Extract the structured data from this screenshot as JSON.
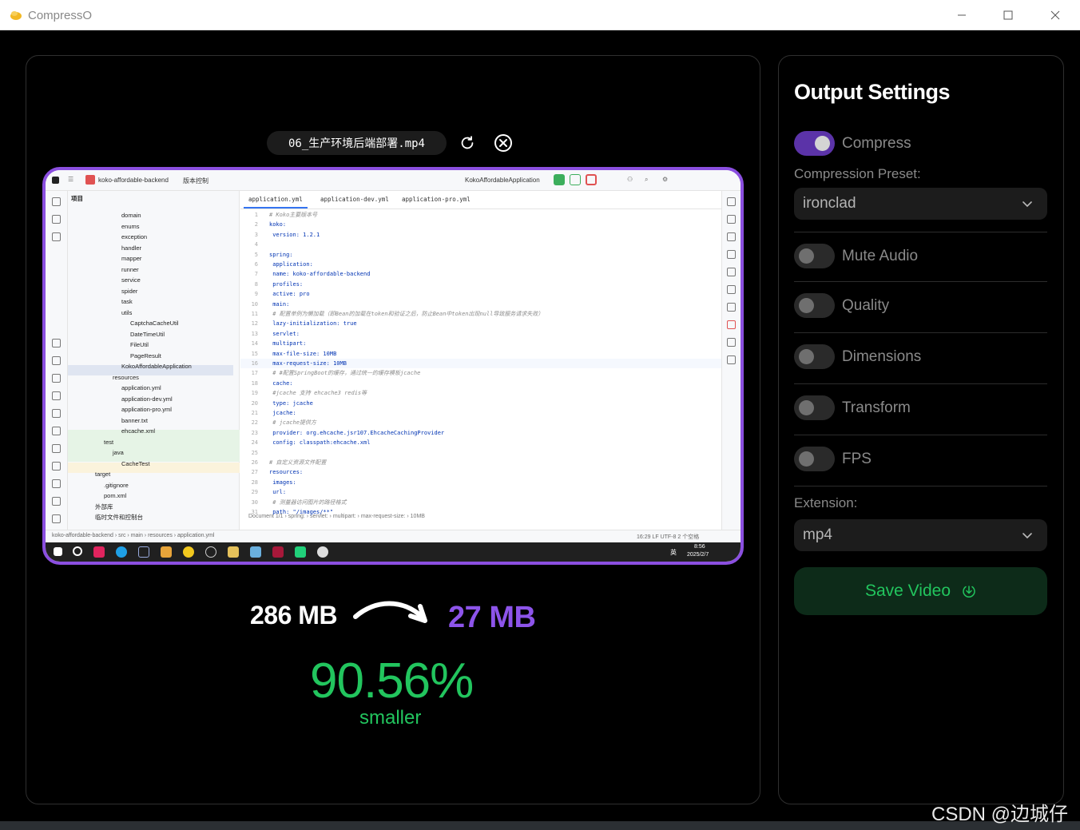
{
  "window": {
    "title": "CompressO",
    "icon": "compresso-logo-icon"
  },
  "preview": {
    "file_name": "06_生产环境后端部署.mp4",
    "ide": {
      "project_name": "koko-affordable-backend",
      "vcs_label": "版本控制",
      "run_config": "KokoAffordableApplication",
      "project_label": "项目",
      "tabs": [
        "application.yml",
        "application-dev.yml",
        "application-pro.yml"
      ],
      "tree": [
        {
          "indent": 3,
          "label": "domain"
        },
        {
          "indent": 3,
          "label": "enums"
        },
        {
          "indent": 3,
          "label": "exception"
        },
        {
          "indent": 3,
          "label": "handler"
        },
        {
          "indent": 3,
          "label": "mapper"
        },
        {
          "indent": 3,
          "label": "runner"
        },
        {
          "indent": 3,
          "label": "service"
        },
        {
          "indent": 3,
          "label": "spider"
        },
        {
          "indent": 3,
          "label": "task"
        },
        {
          "indent": 3,
          "label": "utils"
        },
        {
          "indent": 4,
          "label": "CaptchaCacheUtil"
        },
        {
          "indent": 4,
          "label": "DateTimeUtil"
        },
        {
          "indent": 4,
          "label": "FileUtil"
        },
        {
          "indent": 4,
          "label": "PageResult"
        },
        {
          "indent": 3,
          "label": "KokoAffordableApplication"
        },
        {
          "indent": 2,
          "label": "resources"
        },
        {
          "indent": 3,
          "label": "application.yml"
        },
        {
          "indent": 3,
          "label": "application-dev.yml"
        },
        {
          "indent": 3,
          "label": "application-pro.yml"
        },
        {
          "indent": 3,
          "label": "banner.txt"
        },
        {
          "indent": 3,
          "label": "ehcache.xml"
        },
        {
          "indent": 1,
          "label": "test"
        },
        {
          "indent": 2,
          "label": "java"
        },
        {
          "indent": 3,
          "label": "CacheTest"
        },
        {
          "indent": 0,
          "label": "target"
        },
        {
          "indent": 1,
          "label": ".gitignore"
        },
        {
          "indent": 1,
          "label": "pom.xml"
        },
        {
          "indent": 0,
          "label": "外部库"
        },
        {
          "indent": 0,
          "label": "临时文件和控制台"
        }
      ],
      "code": [
        "# Koko主要版本号",
        "koko:",
        "  version: 1.2.1",
        "",
        "spring:",
        "  application:",
        "    name: koko-affordable-backend",
        "  profiles:",
        "    active: pro",
        "  main:",
        "    # 配置单例为懒加载（即Bean的加载在token和验证之后，防止Bean中token出现null导致服务请求失败）",
        "    lazy-initialization: true",
        "  servlet:",
        "    multipart:",
        "      max-file-size: 10MB",
        "      max-request-size: 10MB",
        "  #  #配置SpringBoot的缓存，通过统一的缓存模板jcache",
        "  cache:",
        "    #jcache 支持 ehcache3 redis等",
        "    type: jcache",
        "    jcache:",
        "      # jcache提供方",
        "      provider: org.ehcache.jsr107.EhcacheCachingProvider",
        "      config: classpath:ehcache.xml",
        "",
        "# 自定义资源文件配置",
        "resources:",
        "  images:",
        "    url:",
        "      # 测量器访问图片的路径格式",
        "      path: \"/images/**\""
      ],
      "breadcrumb_doc": "Document 1/1  ›  spring:  ›  servlet:  ›  multipart:  ›  max-request-size:  ›  10MB",
      "status_path": "koko-affordable-backend  ›  src  ›  main  ›  resources  ›  application.yml",
      "status_right": "16:29   LF   UTF-8   2 个空格",
      "taskbar_time": "8:56",
      "taskbar_date": "2025/2/7",
      "taskbar_lang": "英"
    }
  },
  "result": {
    "original_size": "286 MB",
    "compressed_size": "27 MB",
    "percent": "90.56%",
    "smaller_label": "smaller"
  },
  "settings": {
    "title": "Output Settings",
    "compress": {
      "label": "Compress",
      "on": true
    },
    "preset_label": "Compression Preset:",
    "preset_value": "ironclad",
    "mute_audio": {
      "label": "Mute Audio",
      "on": false
    },
    "quality": {
      "label": "Quality",
      "on": false
    },
    "dimensions": {
      "label": "Dimensions",
      "on": false
    },
    "transform": {
      "label": "Transform",
      "on": false
    },
    "fps": {
      "label": "FPS",
      "on": false
    },
    "extension_label": "Extension:",
    "extension_value": "mp4",
    "save_label": "Save Video"
  },
  "watermark": "CSDN @边城仔",
  "colors": {
    "accent_purple": "#8d54ea",
    "success_green": "#22c55e",
    "save_bg": "#0d2b19"
  }
}
